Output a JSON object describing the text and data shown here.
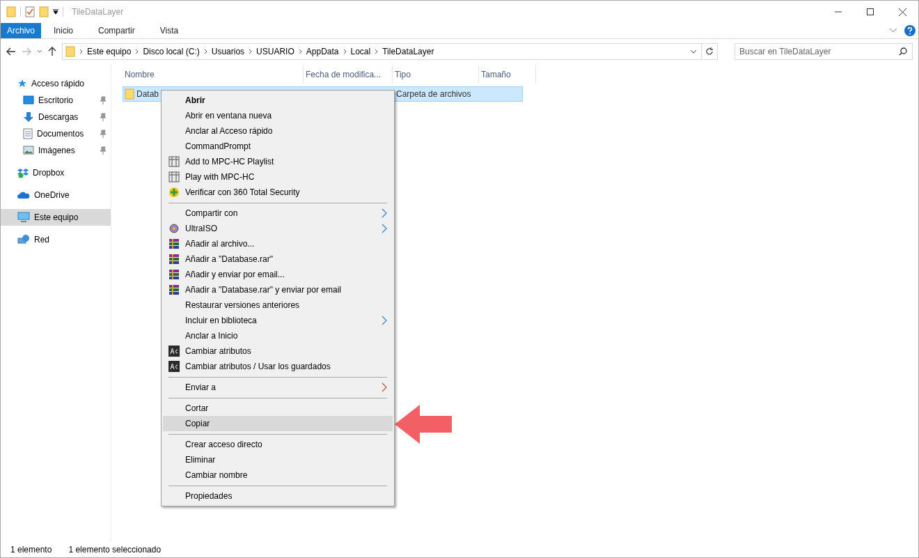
{
  "window": {
    "title": "TileDataLayer"
  },
  "ribbon_tabs": [
    {
      "label": "Archivo",
      "selected": true
    },
    {
      "label": "Inicio",
      "selected": false
    },
    {
      "label": "Compartir",
      "selected": false
    },
    {
      "label": "Vista",
      "selected": false
    }
  ],
  "breadcrumb": [
    "Este equipo",
    "Disco local (C:)",
    "Usuarios",
    "USUARIO",
    "AppData",
    "Local",
    "TileDataLayer"
  ],
  "search": {
    "placeholder": "Buscar en TileDataLayer"
  },
  "sidebar": {
    "items": [
      {
        "label": "Acceso rápido",
        "kind": "star",
        "selected": false,
        "children": [
          {
            "label": "Escritorio",
            "kind": "desktop",
            "pinned": true,
            "selected": false
          },
          {
            "label": "Descargas",
            "kind": "download",
            "pinned": true,
            "selected": false
          },
          {
            "label": "Documentos",
            "kind": "document",
            "pinned": true,
            "selected": false
          },
          {
            "label": "Imágenes",
            "kind": "image",
            "pinned": true,
            "selected": false
          }
        ]
      },
      {
        "label": "Dropbox",
        "kind": "dropbox",
        "selected": false
      },
      {
        "label": "OneDrive",
        "kind": "cloud",
        "selected": false
      },
      {
        "label": "Este equipo",
        "kind": "computer",
        "selected": true
      },
      {
        "label": "Red",
        "kind": "network",
        "selected": false
      }
    ]
  },
  "table": {
    "columns": [
      "Nombre",
      "Fecha de modifica...",
      "Tipo",
      "Tamaño"
    ],
    "rows": [
      {
        "name": "Datab",
        "type": "Carpeta de archivos",
        "selected": true
      }
    ]
  },
  "context_menu": {
    "groups": [
      [
        {
          "label": "Abrir",
          "kind": "plain",
          "default": true,
          "submenu": false,
          "selected": false
        },
        {
          "label": "Abrir en ventana nueva",
          "kind": "plain",
          "default": false,
          "submenu": false,
          "selected": false
        },
        {
          "label": "Anclar al Acceso rápido",
          "kind": "plain",
          "default": false,
          "submenu": false,
          "selected": false
        },
        {
          "label": "CommandPrompt",
          "kind": "plain",
          "default": false,
          "submenu": false,
          "selected": false
        },
        {
          "label": "Add to MPC-HC Playlist",
          "kind": "film",
          "default": false,
          "submenu": false,
          "selected": false
        },
        {
          "label": "Play with MPC-HC",
          "kind": "film",
          "default": false,
          "submenu": false,
          "selected": false
        },
        {
          "label": "Verificar con 360 Total Security",
          "kind": "shield",
          "default": false,
          "submenu": false,
          "selected": false
        }
      ],
      [
        {
          "label": "Compartir con",
          "kind": "plain",
          "default": false,
          "submenu": true,
          "selected": false
        },
        {
          "label": "UltraISO",
          "kind": "disc",
          "default": false,
          "submenu": true,
          "selected": false
        },
        {
          "label": "Añadir al archivo...",
          "kind": "archive",
          "default": false,
          "submenu": false,
          "selected": false
        },
        {
          "label": "Añadir a \"Database.rar\"",
          "kind": "archive",
          "default": false,
          "submenu": false,
          "selected": false
        },
        {
          "label": "Añadir y enviar por email...",
          "kind": "archive",
          "default": false,
          "submenu": false,
          "selected": false
        },
        {
          "label": "Añadir a \"Database.rar\" y enviar por email",
          "kind": "archive",
          "default": false,
          "submenu": false,
          "selected": false
        },
        {
          "label": "Restaurar versiones anteriores",
          "kind": "plain",
          "default": false,
          "submenu": false,
          "selected": false
        },
        {
          "label": "Incluir en biblioteca",
          "kind": "plain",
          "default": false,
          "submenu": true,
          "selected": false
        },
        {
          "label": "Anclar a Inicio",
          "kind": "plain",
          "default": false,
          "submenu": false,
          "selected": false
        },
        {
          "label": "Cambiar atributos",
          "kind": "attrib",
          "default": false,
          "submenu": false,
          "selected": false
        },
        {
          "label": "Cambiar atributos / Usar los guardados",
          "kind": "attrib",
          "default": false,
          "submenu": false,
          "selected": false
        }
      ],
      [
        {
          "label": "Enviar a",
          "kind": "plain",
          "default": false,
          "submenu": true,
          "selected": false
        }
      ],
      [
        {
          "label": "Cortar",
          "kind": "plain",
          "default": false,
          "submenu": false,
          "selected": false
        },
        {
          "label": "Copiar",
          "kind": "plain",
          "default": false,
          "submenu": false,
          "selected": true
        }
      ],
      [
        {
          "label": "Crear acceso directo",
          "kind": "plain",
          "default": false,
          "submenu": false,
          "selected": false
        },
        {
          "label": "Eliminar",
          "kind": "plain",
          "default": false,
          "submenu": false,
          "selected": false
        },
        {
          "label": "Cambiar nombre",
          "kind": "plain",
          "default": false,
          "submenu": false,
          "selected": false
        }
      ],
      [
        {
          "label": "Propiedades",
          "kind": "plain",
          "default": false,
          "submenu": false,
          "selected": false
        }
      ]
    ]
  },
  "status_bar": [
    "1 elemento",
    "1 elemento seleccionado"
  ]
}
